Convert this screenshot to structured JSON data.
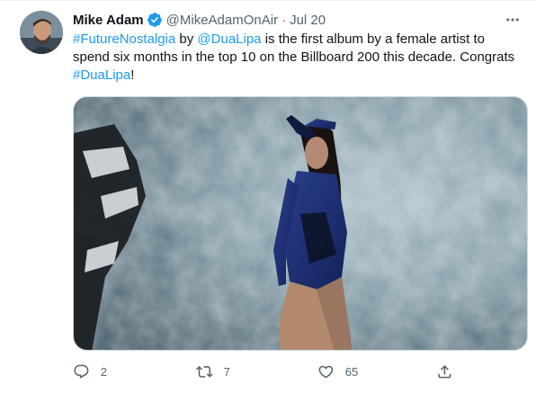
{
  "tweet": {
    "author_name": "Mike Adam",
    "handle": "@MikeAdamOnAir",
    "separator": "·",
    "time": "Jul 20",
    "text_parts": [
      {
        "text": "#FutureNostalgia",
        "link": true
      },
      {
        "text": " by ",
        "link": false
      },
      {
        "text": "@DuaLipa",
        "link": true
      },
      {
        "text": " is the first album by a female artist to spend six months in the top 10 on the Billboard 200 this decade. Congrats ",
        "link": false
      },
      {
        "text": "#DuaLipa",
        "link": true
      },
      {
        "text": "!",
        "link": false
      }
    ]
  },
  "actions": {
    "reply_count": "2",
    "retweet_count": "7",
    "like_count": "65"
  },
  "icons": {
    "verified": "verified-badge-icon",
    "more": "more-options-icon",
    "reply": "reply-icon",
    "retweet": "retweet-icon",
    "like": "heart-icon",
    "share": "share-icon"
  },
  "colors": {
    "link": "#1d9bf0",
    "secondary_text": "#536471",
    "primary_text": "#0f1419",
    "verified": "#1d9bf0"
  }
}
